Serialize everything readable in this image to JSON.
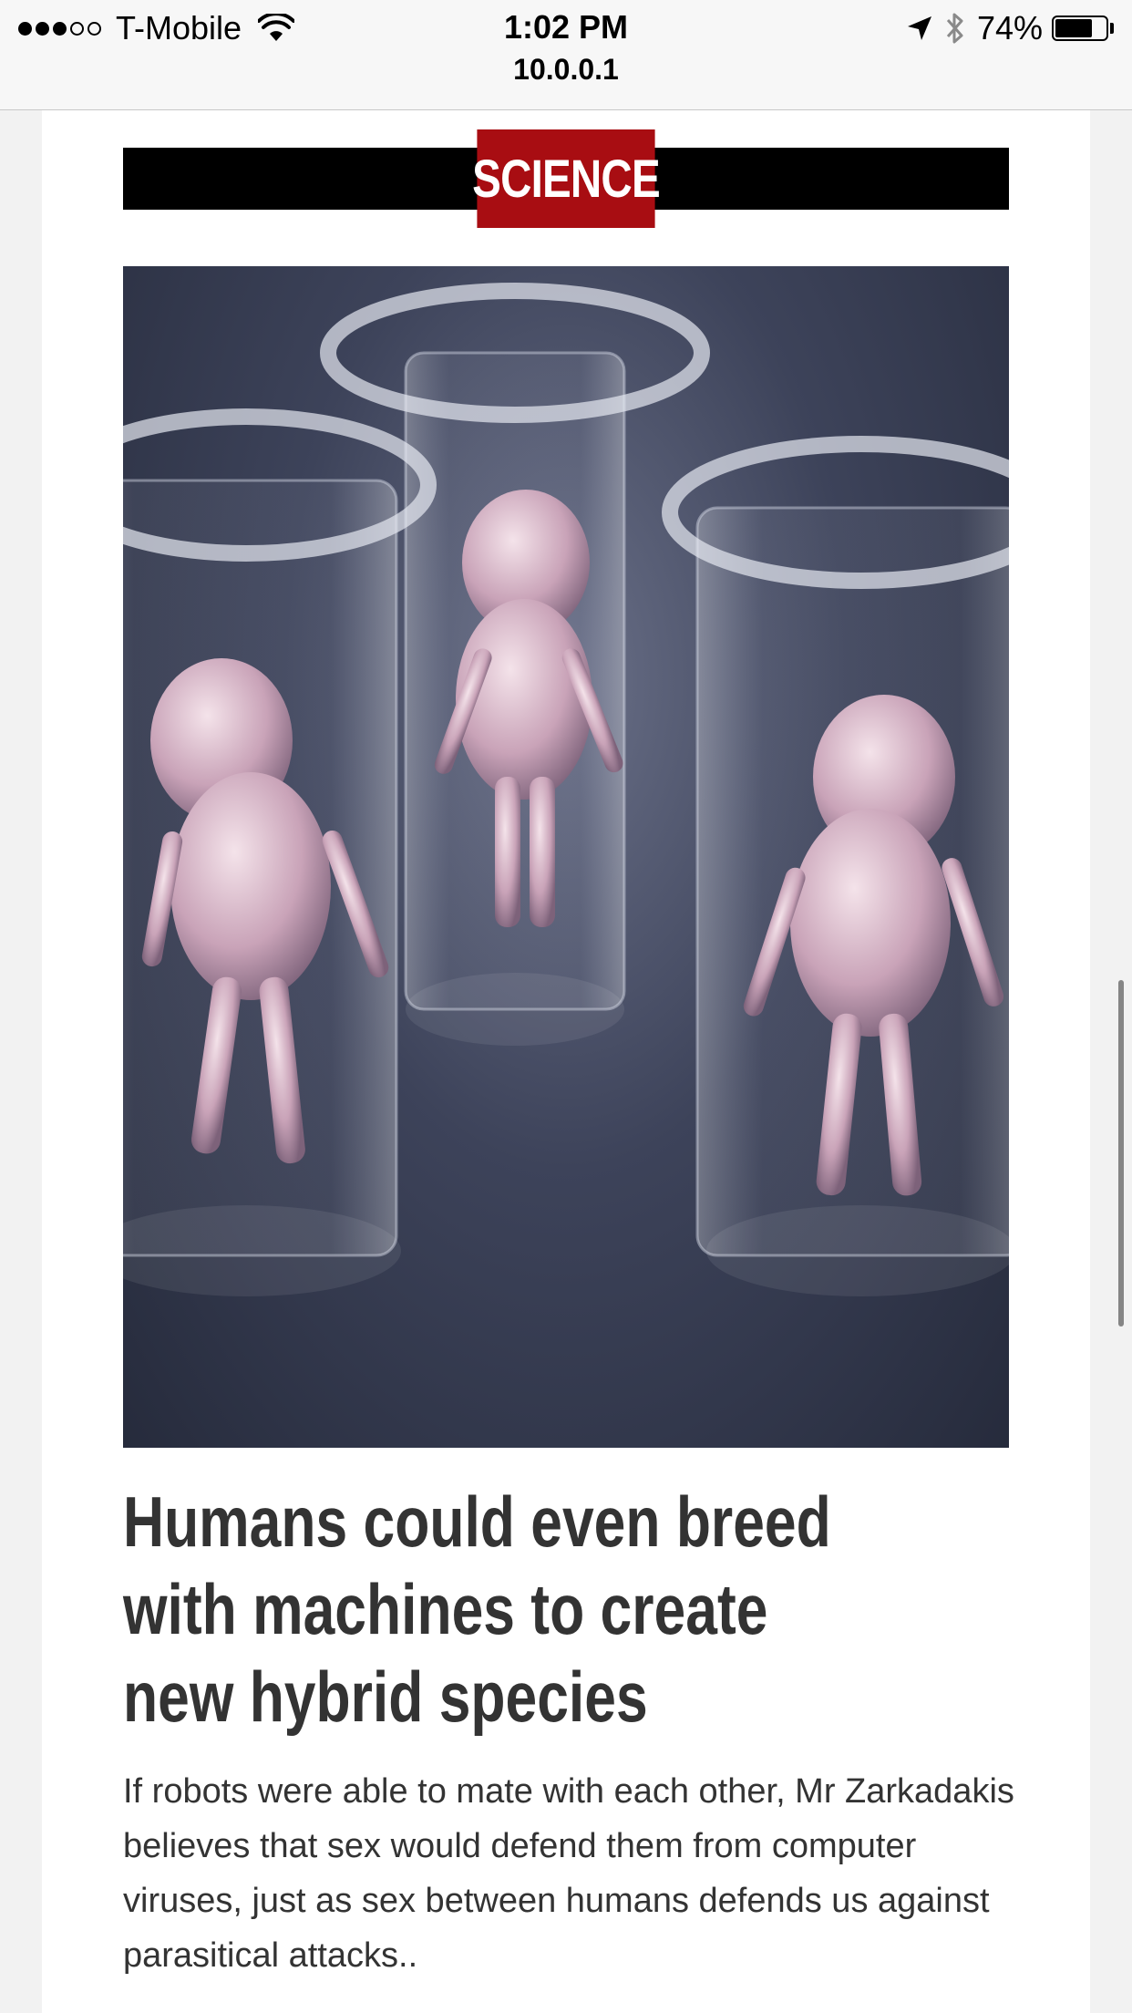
{
  "status_bar": {
    "carrier": "T-Mobile",
    "time": "1:02 PM",
    "url": "10.0.0.1",
    "battery_percent": "74%",
    "battery_level": 0.74,
    "signal_bars_filled": 3,
    "signal_bars_total": 5,
    "icons": [
      "wifi-icon",
      "location-arrow-icon",
      "bluetooth-icon",
      "battery-icon"
    ]
  },
  "article": {
    "section": "SCIENCE",
    "section_color": "#a80d12",
    "image_description": "hero-image",
    "headline": "Humans could even breed with machines to create new hybrid species",
    "summary": "If robots were able to mate with each other, Mr Zarkadakis believes that sex would defend them from computer viruses, just as sex between humans defends us against parasitical attacks.."
  }
}
